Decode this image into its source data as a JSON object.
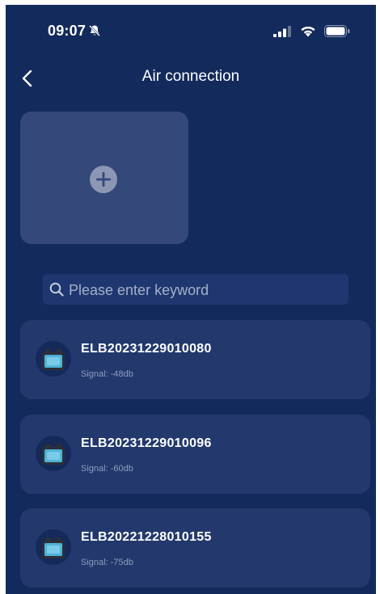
{
  "status_bar": {
    "time": "09:07",
    "icons": [
      "bell-slash-icon",
      "cellular-signal-icon",
      "wifi-icon",
      "battery-icon"
    ]
  },
  "header": {
    "title": "Air connection",
    "back_icon": "chevron-left-icon"
  },
  "add_card": {
    "icon": "plus-circle-icon"
  },
  "search": {
    "placeholder": "Please enter keyword",
    "value": "",
    "icon": "search-icon"
  },
  "devices": [
    {
      "name": "ELB20231229010080",
      "signal": "Signal: -48db",
      "icon": "battery-device-icon"
    },
    {
      "name": "ELB20231229010096",
      "signal": "Signal: -60db",
      "icon": "battery-device-icon"
    },
    {
      "name": "ELB20221228010155",
      "signal": "Signal: -75db",
      "icon": "battery-device-icon"
    }
  ],
  "colors": {
    "background": "#132a5c",
    "card": "#23396d",
    "add_card": "#34487a",
    "search_field": "#1f3770",
    "device_accent": "#4fb3d9"
  }
}
